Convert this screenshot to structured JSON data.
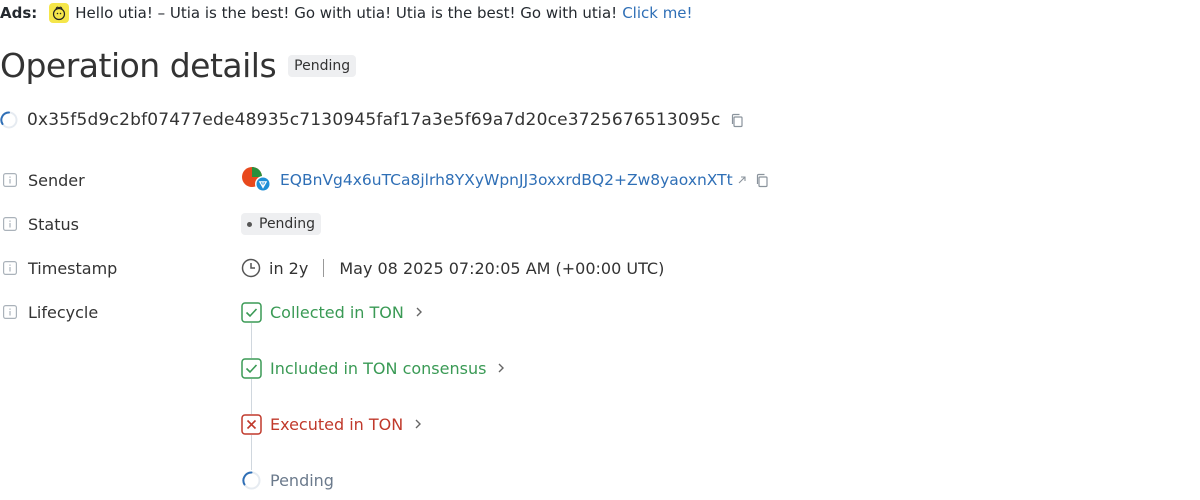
{
  "ads": {
    "label": "Ads:",
    "text": "Hello utia! – Utia is the best! Go with utia! Utia is the best! Go with utia!",
    "link": "Click me!"
  },
  "header": {
    "title": "Operation details",
    "badge": "Pending",
    "hash": "0x35f5d9c2bf07477ede48935c7130945faf17a3e5f69a7d20ce3725676513095c"
  },
  "details": {
    "sender": {
      "label": "Sender",
      "address": "EQBnVg4x6uTCa8jlrh8YXyWpnJJ3oxxrdBQ2+Zw8yaoxnXTt"
    },
    "status": {
      "label": "Status",
      "value": "Pending"
    },
    "timestamp": {
      "label": "Timestamp",
      "relative": "in 2y",
      "absolute": "May 08 2025 07:20:05 AM (+00:00 UTC)"
    },
    "lifecycle": {
      "label": "Lifecycle",
      "steps": [
        {
          "label": "Collected in TON",
          "state": "success"
        },
        {
          "label": "Included in TON consensus",
          "state": "success"
        },
        {
          "label": "Executed in TON",
          "state": "error"
        },
        {
          "label": "Pending",
          "state": "pending"
        }
      ]
    }
  },
  "colors": {
    "link": "#2f6fb6",
    "success": "#3a9a55",
    "error": "#c0392b",
    "pending": "#6b7a8c",
    "spinner": "#2f6fb6"
  }
}
